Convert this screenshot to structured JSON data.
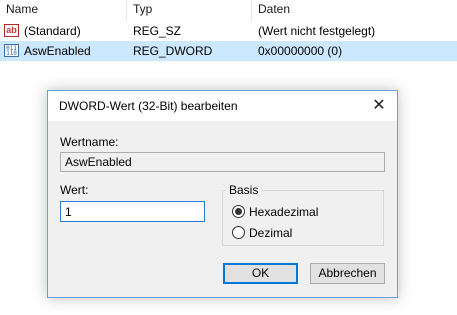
{
  "list": {
    "columns": [
      "Name",
      "Typ",
      "Daten"
    ],
    "rows": [
      {
        "icon": "reg-string-icon",
        "icon_glyph": "ab",
        "name": "(Standard)",
        "type": "REG_SZ",
        "data": "(Wert nicht festgelegt)"
      },
      {
        "icon": "reg-dword-icon",
        "icon_glyph": "011 110",
        "name": "AswEnabled",
        "type": "REG_DWORD",
        "data": "0x00000000 (0)"
      }
    ]
  },
  "dialog": {
    "title": "DWORD-Wert (32-Bit) bearbeiten",
    "close_glyph": "✕",
    "value_name_label": "Wertname:",
    "value_name": "AswEnabled",
    "value_data_label": "Wert:",
    "value_data": "1",
    "base_label": "Basis",
    "hex_label": "Hexadezimal",
    "dec_label": "Dezimal",
    "base_selected": "hex",
    "ok": "OK",
    "cancel": "Abbrechen"
  },
  "colors": {
    "selection": "#cce8ff",
    "accent": "#0078d7"
  }
}
